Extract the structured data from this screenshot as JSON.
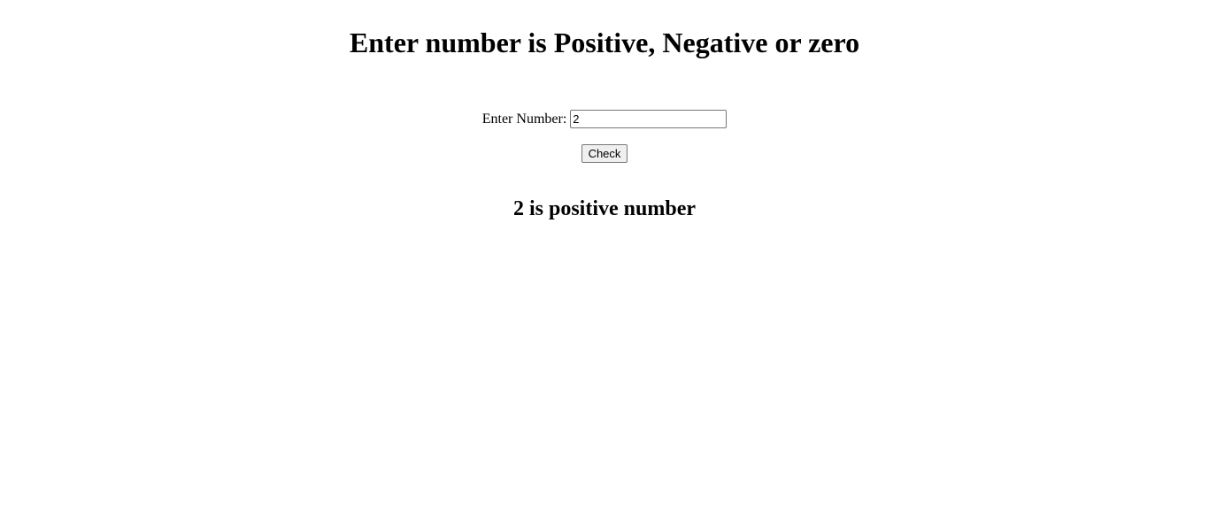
{
  "page": {
    "title": "Enter number is Positive, Negative or zero"
  },
  "form": {
    "label": "Enter Number:",
    "input_value": "2",
    "check_label": "Check"
  },
  "result": {
    "text": "2 is positive number"
  },
  "colors": {
    "background": "#ffffff",
    "text": "#000000",
    "button_bg": "#efefef",
    "border": "#767676"
  }
}
